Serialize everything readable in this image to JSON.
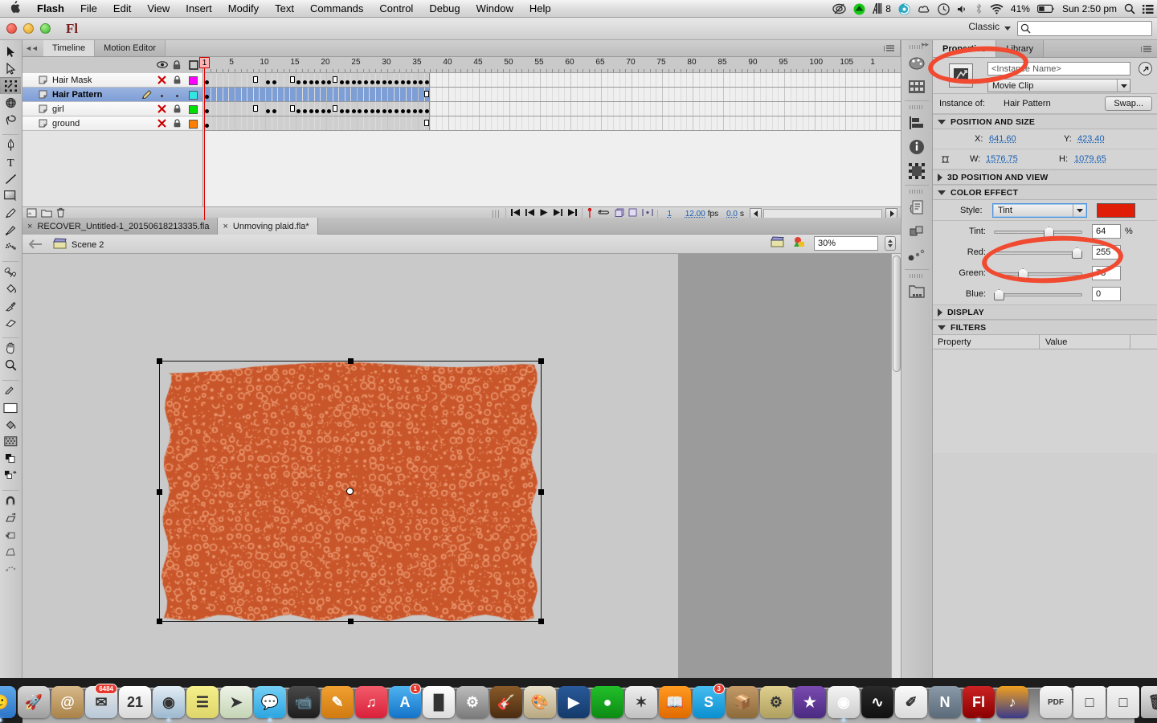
{
  "menubar": {
    "apple_icon": "apple-icon",
    "items": [
      {
        "label": "Flash",
        "bold": true
      },
      {
        "label": "File",
        "bold": false
      },
      {
        "label": "Edit",
        "bold": false
      },
      {
        "label": "View",
        "bold": false
      },
      {
        "label": "Insert",
        "bold": false
      },
      {
        "label": "Modify",
        "bold": false
      },
      {
        "label": "Text",
        "bold": false
      },
      {
        "label": "Commands",
        "bold": false
      },
      {
        "label": "Control",
        "bold": false
      },
      {
        "label": "Debug",
        "bold": false
      },
      {
        "label": "Window",
        "bold": false
      },
      {
        "label": "Help",
        "bold": false
      }
    ],
    "status": {
      "creative_cloud_icon": "creative-cloud-icon",
      "dropbox_icon": "dropbox-icon",
      "adobe_icon": "adobe-a-icon",
      "adobe_count": "8",
      "spinner_icon": "spinner-icon",
      "cloud_icon": "cloud-icon",
      "timemachine_icon": "time-machine-icon",
      "volume_icon": "volume-icon",
      "bluetooth_icon": "bluetooth-icon",
      "wifi_icon": "wifi-icon",
      "battery_percent": "41%",
      "battery_icon": "battery-icon",
      "clock": "Sun 2:50 pm",
      "spotlight_icon": "search-icon",
      "notification_icon": "notification-center-icon"
    }
  },
  "app": {
    "logo": "Fl",
    "workspace": "Classic",
    "search_placeholder": ""
  },
  "toolbar": {
    "tools": [
      {
        "name": "selection-tool",
        "selected": false
      },
      {
        "name": "subselection-tool",
        "selected": false
      },
      {
        "name": "free-transform-tool",
        "selected": true
      },
      {
        "name": "3d-rotation-tool",
        "selected": false
      },
      {
        "name": "lasso-tool",
        "selected": false
      },
      {
        "name": "pen-tool",
        "selected": false
      },
      {
        "name": "text-tool",
        "selected": false
      },
      {
        "name": "line-tool",
        "selected": false
      },
      {
        "name": "rectangle-tool",
        "selected": false
      },
      {
        "name": "pencil-tool",
        "selected": false
      },
      {
        "name": "brush-tool",
        "selected": false
      },
      {
        "name": "spray-brush-tool",
        "selected": false
      },
      {
        "name": "bone-tool",
        "selected": false
      },
      {
        "name": "paint-bucket-tool",
        "selected": false
      },
      {
        "name": "eyedropper-tool",
        "selected": false
      },
      {
        "name": "eraser-tool",
        "selected": false
      },
      {
        "name": "hand-tool",
        "selected": false
      },
      {
        "name": "zoom-tool",
        "selected": false
      },
      {
        "name": "stroke-color-tool",
        "selected": false
      },
      {
        "name": "fill-color-tool",
        "selected": false
      },
      {
        "name": "black-white-tool",
        "selected": false
      },
      {
        "name": "swap-colors-tool",
        "selected": false
      },
      {
        "name": "snap-to-objects-option",
        "selected": false
      },
      {
        "name": "scale-option",
        "selected": false
      },
      {
        "name": "rotate-option",
        "selected": false
      },
      {
        "name": "distort-option",
        "selected": false
      },
      {
        "name": "envelope-option",
        "selected": false
      }
    ]
  },
  "timeline": {
    "tabs": [
      {
        "label": "Timeline",
        "active": true
      },
      {
        "label": "Motion Editor",
        "active": false
      }
    ],
    "header_icons": [
      "eye-icon",
      "lock-icon",
      "outline-icon"
    ],
    "layers": [
      {
        "name": "Hair Mask",
        "visible": false,
        "locked": true,
        "color": "#ff00ff",
        "selected": false,
        "editing": false
      },
      {
        "name": "Hair Pattern",
        "visible": true,
        "locked": false,
        "color": "#33e6e6",
        "selected": true,
        "editing": true
      },
      {
        "name": "girl",
        "visible": false,
        "locked": true,
        "color": "#00e000",
        "selected": false,
        "editing": false
      },
      {
        "name": "ground",
        "visible": false,
        "locked": true,
        "color": "#ff8000",
        "selected": false,
        "editing": false
      }
    ],
    "frame_numbers": [
      "1",
      "5",
      "10",
      "15",
      "20",
      "25",
      "30",
      "35",
      "40",
      "45",
      "50",
      "55",
      "60",
      "65",
      "70",
      "75",
      "80",
      "85",
      "90",
      "95",
      "100",
      "105",
      "1"
    ],
    "current_frame": "1",
    "status": {
      "frame": "1",
      "fps": "12.00",
      "fps_label": "fps",
      "elapsed": "0.0",
      "elapsed_unit": "s"
    },
    "controls": [
      "new-layer-icon",
      "new-folder-icon",
      "delete-layer-icon",
      "goto-first-frame-icon",
      "step-back-icon",
      "play-icon",
      "step-forward-icon",
      "goto-last-frame-icon",
      "onion-skin-icon",
      "loop-icon",
      "edit-multiple-frames-icon",
      "modify-onion-markers-icon",
      "center-frame-icon"
    ]
  },
  "documents": {
    "tabs": [
      {
        "label": "RECOVER_Untitled-1_20150618213335.fla",
        "active": false
      },
      {
        "label": "Unmoving plaid.fla*",
        "active": true
      }
    ]
  },
  "scene": {
    "back_icon": "back-arrow-icon",
    "scene_icon": "scene-clapboard-icon",
    "name": "Scene 2",
    "edit_scene_icon": "edit-scene-icon",
    "edit_symbol_icon": "edit-symbol-icon",
    "zoom": "30%"
  },
  "stage": {
    "artwork_base_color": "#c9562a",
    "artwork_speckle_color": "#e8936a",
    "selection": {
      "handles": 8,
      "registration": "center-registration-point"
    }
  },
  "dock_strip": {
    "icons": [
      "color-panel-icon",
      "swatches-panel-icon",
      "align-panel-icon",
      "info-panel-icon",
      "transform-panel-icon",
      "actions-panel-icon",
      "components-panel-icon",
      "motion-presets-panel-icon",
      "project-panel-icon"
    ]
  },
  "properties": {
    "tabs": [
      {
        "label": "Properties",
        "active": true
      },
      {
        "label": "Library",
        "active": false
      }
    ],
    "symbol_thumb_icon": "movieclip-symbol-icon",
    "instance_name_placeholder": "<Instance Name>",
    "accessibility_icon": "accessibility-icon",
    "symbol_type": "Movie Clip",
    "instance_of_label": "Instance of:",
    "instance_of_value": "Hair Pattern",
    "swap_label": "Swap...",
    "sections": {
      "position_and_size": {
        "label": "POSITION AND SIZE",
        "open": true
      },
      "three_d": {
        "label": "3D POSITION AND VIEW",
        "open": false
      },
      "color_effect": {
        "label": "COLOR EFFECT",
        "open": true
      },
      "display": {
        "label": "DISPLAY",
        "open": false
      },
      "filters": {
        "label": "FILTERS",
        "open": true
      }
    },
    "position": {
      "x_label": "X:",
      "x_value": "641.60",
      "y_label": "Y:",
      "y_value": "423.40",
      "w_label": "W:",
      "w_value": "1576.75",
      "h_label": "H:",
      "h_value": "1079.65",
      "lock_ratio_icon": "link-wh-icon"
    },
    "color_effect": {
      "style_label": "Style:",
      "style_value": "Tint",
      "swatch_color": "#e01d07",
      "sliders": [
        {
          "label": "Tint:",
          "value": "64",
          "unit": "%",
          "pos": 0.64
        },
        {
          "label": "Red:",
          "value": "255",
          "unit": "",
          "pos": 1.0
        },
        {
          "label": "Green:",
          "value": "78",
          "unit": "",
          "pos": 0.306
        },
        {
          "label": "Blue:",
          "value": "0",
          "unit": "",
          "pos": 0.0
        }
      ]
    },
    "filters": {
      "col_property": "Property",
      "col_value": "Value",
      "bottom_icons": [
        "add-filter-icon",
        "preset-filter-icon",
        "clipboard-filter-icon",
        "enable-filter-icon",
        "reset-filter-icon",
        "delete-filter-icon"
      ]
    }
  },
  "annotations": [
    {
      "name": "properties-tab-highlight"
    },
    {
      "name": "tint-style-highlight"
    }
  ],
  "dock": {
    "items": [
      {
        "name": "finder",
        "color1": "#5ea8e8",
        "color2": "#2b74c7",
        "glyph": "🙂",
        "badge": null
      },
      {
        "name": "launchpad",
        "color1": "#d8d8d8",
        "color2": "#9e9e9e",
        "glyph": "🚀",
        "badge": null
      },
      {
        "name": "dictionary",
        "color1": "#d8b98a",
        "color2": "#a98248",
        "glyph": "@",
        "badge": null
      },
      {
        "name": "mail",
        "color1": "#eaeaea",
        "color2": "#b8c8d8",
        "glyph": "✉",
        "badge": "6484"
      },
      {
        "name": "calendar",
        "color1": "#ffffff",
        "color2": "#d8d8d8",
        "glyph": "21",
        "badge": null
      },
      {
        "name": "safari",
        "color1": "#e3edf5",
        "color2": "#9bb8cf",
        "glyph": "◉",
        "badge": null
      },
      {
        "name": "stickies",
        "color1": "#f5f08c",
        "color2": "#ded46a",
        "glyph": "☰",
        "badge": null
      },
      {
        "name": "maps",
        "color1": "#eef3e8",
        "color2": "#c4d4b4",
        "glyph": "➤",
        "badge": null
      },
      {
        "name": "messages",
        "color1": "#74d0f5",
        "color2": "#2ba4e0",
        "glyph": "💬",
        "badge": null
      },
      {
        "name": "facetime",
        "color1": "#4a4a4a",
        "color2": "#1d1d1d",
        "glyph": "📹",
        "badge": null
      },
      {
        "name": "pages",
        "color1": "#f0a030",
        "color2": "#d07a10",
        "glyph": "✎",
        "badge": null
      },
      {
        "name": "itunes",
        "color1": "#f25c6a",
        "color2": "#d9203a",
        "glyph": "♫",
        "badge": null
      },
      {
        "name": "app-store",
        "color1": "#4fb3f0",
        "color2": "#1473c9",
        "glyph": "A",
        "badge": "1"
      },
      {
        "name": "numbers",
        "color1": "#ffffff",
        "color2": "#dcdcdc",
        "glyph": "█",
        "badge": null
      },
      {
        "name": "system-preferences",
        "color1": "#bdbdbd",
        "color2": "#7a7a7a",
        "glyph": "⚙",
        "badge": null
      },
      {
        "name": "garageband",
        "color1": "#8a5a2a",
        "color2": "#4a2c10",
        "glyph": "🎸",
        "badge": null
      },
      {
        "name": "iphoto",
        "color1": "#e8e0cc",
        "color2": "#b8a880",
        "glyph": "🎨",
        "badge": null
      },
      {
        "name": "keynote",
        "color1": "#2a5a9a",
        "color2": "#143a6a",
        "glyph": "▶",
        "badge": null
      },
      {
        "name": "evernote",
        "color1": "#22c02a",
        "color2": "#0d8a14",
        "glyph": "●",
        "badge": null
      },
      {
        "name": "app-colorful",
        "color1": "#f0f0f0",
        "color2": "#c0c0c0",
        "glyph": "✶",
        "badge": null
      },
      {
        "name": "ibooks",
        "color1": "#ff9a20",
        "color2": "#e06a00",
        "glyph": "📖",
        "badge": null
      },
      {
        "name": "skype",
        "color1": "#46bdf0",
        "color2": "#0a8fd0",
        "glyph": "S",
        "badge": "3"
      },
      {
        "name": "archive-utility",
        "color1": "#c49a68",
        "color2": "#8c6a3a",
        "glyph": "📦",
        "badge": null
      },
      {
        "name": "script-editor",
        "color1": "#e0d090",
        "color2": "#b0a060",
        "glyph": "⚙",
        "badge": null
      },
      {
        "name": "imovie",
        "color1": "#7a4ab0",
        "color2": "#4a2a80",
        "glyph": "★",
        "badge": null
      },
      {
        "name": "chrome",
        "color1": "#f5f5f5",
        "color2": "#cccccc",
        "glyph": "◉",
        "badge": null
      },
      {
        "name": "activity-monitor",
        "color1": "#2a2a2a",
        "color2": "#101010",
        "glyph": "∿",
        "badge": null
      },
      {
        "name": "textedit",
        "color1": "#fafafa",
        "color2": "#dadada",
        "glyph": "✐",
        "badge": null
      },
      {
        "name": "notational-velocity",
        "color1": "#8a9aa8",
        "color2": "#5a6a78",
        "glyph": "N",
        "badge": null
      },
      {
        "name": "flash-professional",
        "color1": "#cc2222",
        "color2": "#8a0000",
        "glyph": "Fl",
        "badge": null
      },
      {
        "name": "audacity",
        "color1": "#f0a020",
        "color2": "#3a3a8a",
        "glyph": "♪",
        "badge": null
      },
      {
        "name": "pdf-document",
        "color1": "#f8f8f8",
        "color2": "#d0d0d0",
        "glyph": "PDF",
        "badge": null
      },
      {
        "name": "finder-window-1",
        "color1": "#f4f4f4",
        "color2": "#dcdcdc",
        "glyph": "□",
        "badge": null
      },
      {
        "name": "finder-window-2",
        "color1": "#f4f4f4",
        "color2": "#dcdcdc",
        "glyph": "□",
        "badge": null
      },
      {
        "name": "trash",
        "color1": "#e8e8e8",
        "color2": "#aaaaaa",
        "glyph": "🗑",
        "badge": null
      }
    ]
  }
}
